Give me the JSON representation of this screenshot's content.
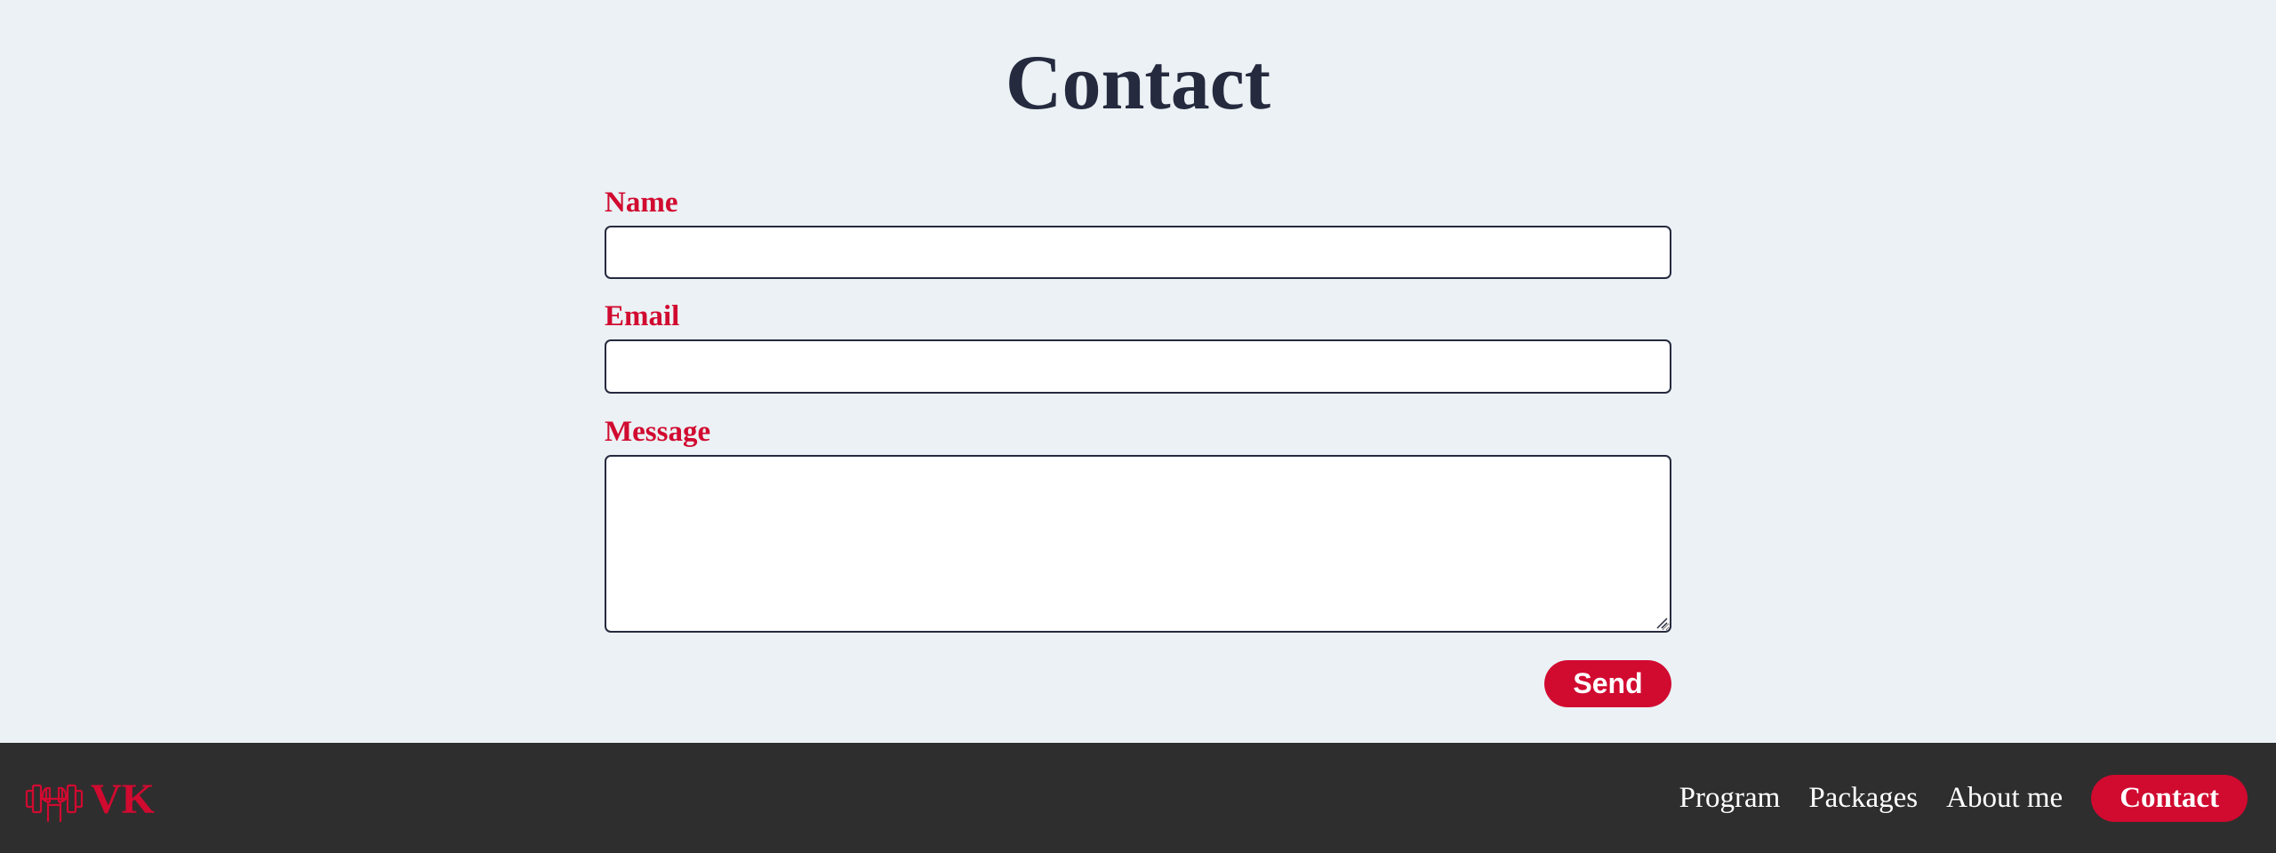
{
  "main": {
    "title": "Contact"
  },
  "form": {
    "name_label": "Name",
    "name_value": "",
    "email_label": "Email",
    "email_value": "",
    "message_label": "Message",
    "message_value": "",
    "send_label": "Send"
  },
  "footer": {
    "logo_icon": "dumbbell-icon",
    "logo_text": "VK",
    "nav": [
      {
        "label": "Program"
      },
      {
        "label": "Packages"
      },
      {
        "label": "About me"
      },
      {
        "label": "Contact",
        "active": true
      }
    ]
  },
  "colors": {
    "page_background": "#ebf1f4",
    "title": "#262a3f",
    "accent": "#d10a30",
    "footer_background": "#2e2e2e",
    "nav_text": "#ffffff"
  }
}
